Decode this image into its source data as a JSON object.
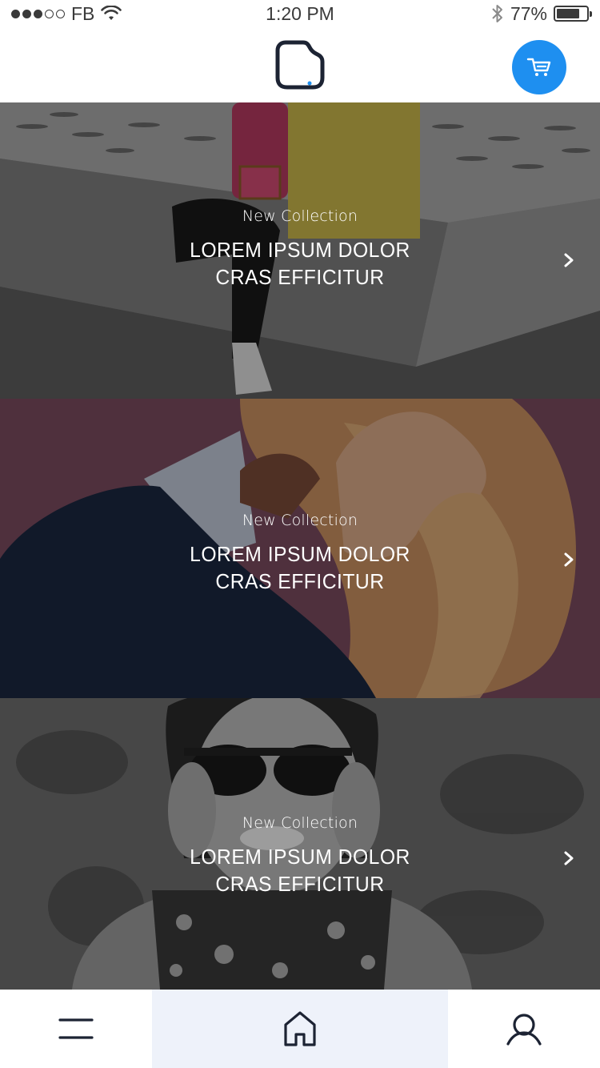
{
  "status_bar": {
    "carrier": "FB",
    "time": "1:20 PM",
    "battery": "77%",
    "battery_level": 0.77,
    "signal_bars_filled": 3,
    "signal_bars_total": 5,
    "icons": [
      "wifi-icon",
      "bluetooth-icon",
      "battery-icon"
    ]
  },
  "header": {
    "logo": "app-logo",
    "cart_icon": "cart-icon",
    "accent_color": "#1e8ff0"
  },
  "banners": [
    {
      "eyebrow": "New Collection",
      "title_line1": "LOREM IPSUM DOLOR",
      "title_line2": "CRAS EFFICITUR",
      "image": "grayscale photo of person in yellow coat with red backpack sitting on concrete ledge",
      "icon": "chevron-right-icon"
    },
    {
      "eyebrow": "New Collection",
      "title_line1": "LOREM IPSUM DOLOR",
      "title_line2": "CRAS EFFICITUR",
      "image": "photo of man in dark sweater with hand in blonde hair on mauve background",
      "icon": "chevron-right-icon"
    },
    {
      "eyebrow": "New Collection",
      "title_line1": "LOREM IPSUM DOLOR",
      "title_line2": "CRAS EFFICITUR",
      "image": "grayscale photo of laughing woman in sunglasses against textured wall",
      "icon": "chevron-right-icon"
    }
  ],
  "tab_bar": {
    "tabs": [
      {
        "icon": "menu-icon",
        "active": false
      },
      {
        "icon": "home-icon",
        "active": true
      },
      {
        "icon": "user-icon",
        "active": false
      }
    ],
    "active_background": "#eef2fa"
  }
}
